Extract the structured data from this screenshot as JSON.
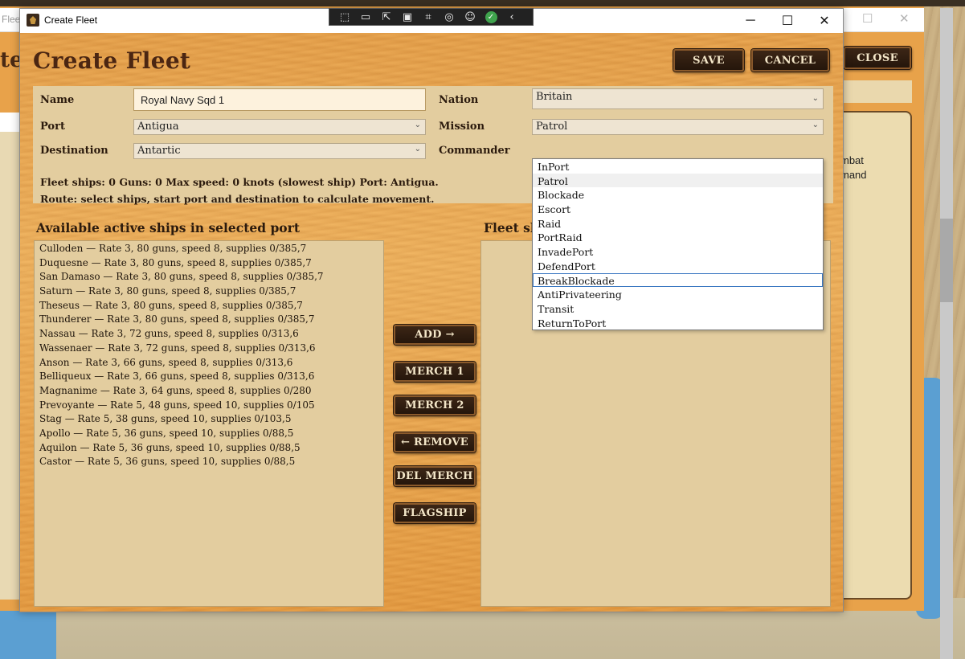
{
  "background": {
    "title_fragment": "Flee",
    "left_heading_fragment": "te",
    "close_label": "CLOSE",
    "pane_lines": [
      "mbat",
      "mand"
    ]
  },
  "window": {
    "title": "Create Fleet",
    "minimize_glyph": "─",
    "maximize_glyph": "☐",
    "close_glyph": "✕"
  },
  "overlay_toolbar": {
    "icons": [
      "cursor-select-icon",
      "video-icon",
      "pointer-icon",
      "frame-icon",
      "screen-region-icon",
      "broadcast-icon",
      "accessibility-icon",
      "ok-check-icon",
      "collapse-icon"
    ]
  },
  "header": {
    "title": "Create Fleet",
    "save_label": "SAVE",
    "cancel_label": "CANCEL"
  },
  "form": {
    "name_label": "Name",
    "name_value": "Royal Navy Sqd 1",
    "nation_label": "Nation",
    "nation_value": "Britain",
    "port_label": "Port",
    "port_value": "Antigua",
    "mission_label": "Mission",
    "mission_value": "Patrol",
    "destination_label": "Destination",
    "destination_value": "Antartic",
    "commander_label": "Commander",
    "summary": "Fleet ships: 0   Guns: 0   Max speed: 0 knots (slowest ship)   Port: Antigua.",
    "route": "Route: select ships, start port and destination to calculate movement."
  },
  "available": {
    "title": "Available active ships in selected port",
    "ships": [
      "Culloden — Rate 3, 80 guns, speed 8, supplies 0/385,7",
      "Duquesne — Rate 3, 80 guns, speed 8, supplies 0/385,7",
      "San Damaso — Rate 3, 80 guns, speed 8, supplies 0/385,7",
      "Saturn — Rate 3, 80 guns, speed 8, supplies 0/385,7",
      "Theseus — Rate 3, 80 guns, speed 8, supplies 0/385,7",
      "Thunderer — Rate 3, 80 guns, speed 8, supplies 0/385,7",
      "Nassau — Rate 3, 72 guns, speed 8, supplies 0/313,6",
      "Wassenaer — Rate 3, 72 guns, speed 8, supplies 0/313,6",
      "Anson — Rate 3, 66 guns, speed 8, supplies 0/313,6",
      "Belliqueux — Rate 3, 66 guns, speed 8, supplies 0/313,6",
      "Magnanime — Rate 3, 64 guns, speed 8, supplies 0/280",
      "Prevoyante — Rate 5, 48 guns, speed 10, supplies 0/105",
      "Stag — Rate 5, 38 guns, speed 10, supplies 0/103,5",
      "Apollo — Rate 5, 36 guns, speed 10, supplies 0/88,5",
      "Aquilon — Rate 5, 36 guns, speed 10, supplies 0/88,5",
      "Castor — Rate 5, 36 guns, speed 10, supplies 0/88,5"
    ]
  },
  "fleet": {
    "title": "Fleet sh"
  },
  "actions": {
    "add": "ADD →",
    "merch1": "MERCH 1",
    "merch2": "MERCH 2",
    "remove": "← REMOVE",
    "del_merch": "DEL MERCH",
    "flagship": "FLAGSHIP"
  },
  "mission_dropdown": {
    "options": [
      "InPort",
      "Patrol",
      "Blockade",
      "Escort",
      "Raid",
      "PortRaid",
      "InvadePort",
      "DefendPort",
      "BreakBlockade",
      "AntiPrivateering",
      "Transit",
      "ReturnToPort"
    ],
    "selected": "Patrol",
    "focused": "BreakBlockade"
  },
  "colors": {
    "wood": "#e7a24c",
    "parchment": "#e3cd9f",
    "button_dark": "#2b1a0d",
    "button_border": "#8b5a2b",
    "title_brown": "#4b2612"
  }
}
